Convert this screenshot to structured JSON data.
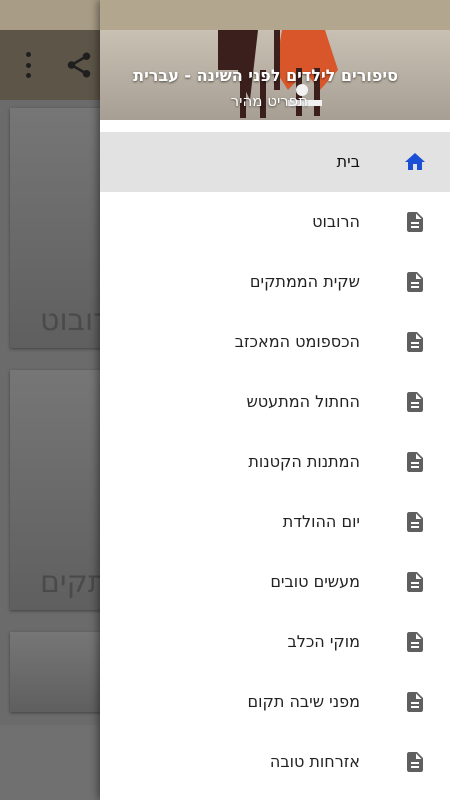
{
  "app": {
    "background_card_texts": [
      "הרובוט",
      "ממתקים"
    ]
  },
  "drawer": {
    "title": "סיפורים לילדים לפני השינה - עברית",
    "subtitle": "תפריט מהיר",
    "items": [
      {
        "label": "בית",
        "icon": "home-icon",
        "active": true
      },
      {
        "label": "הרובוט",
        "icon": "document-icon",
        "active": false
      },
      {
        "label": "שקית הממתקים",
        "icon": "document-icon",
        "active": false
      },
      {
        "label": "הכספומט המאכזב",
        "icon": "document-icon",
        "active": false
      },
      {
        "label": "החתול המתעטש",
        "icon": "document-icon",
        "active": false
      },
      {
        "label": "המתנות הקטנות",
        "icon": "document-icon",
        "active": false
      },
      {
        "label": "יום ההולדת",
        "icon": "document-icon",
        "active": false
      },
      {
        "label": "מעשים טובים",
        "icon": "document-icon",
        "active": false
      },
      {
        "label": "מוקי הכלב",
        "icon": "document-icon",
        "active": false
      },
      {
        "label": "מפני שיבה תקום",
        "icon": "document-icon",
        "active": false
      },
      {
        "label": "אזרחות טובה",
        "icon": "document-icon",
        "active": false
      }
    ]
  },
  "colors": {
    "home_icon": "#1a4fd6",
    "document_icon": "#5f5f5f",
    "active_bg": "#e2e2e2",
    "header_bg": "#a89c86"
  }
}
